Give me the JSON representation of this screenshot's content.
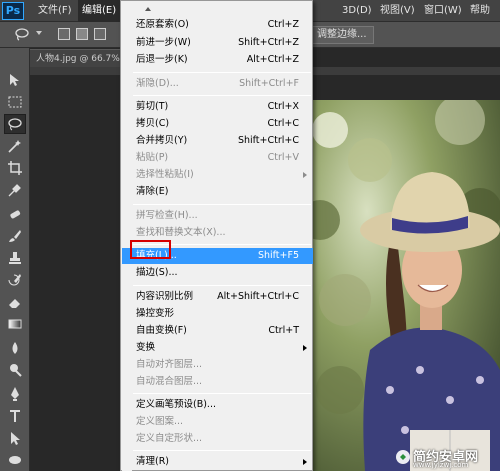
{
  "app": {
    "logo": "Ps"
  },
  "menubar": {
    "items": [
      "文件(F)",
      "编辑(E)",
      "3D(D)",
      "视图(V)",
      "窗口(W)",
      "帮助"
    ],
    "active_index": 1
  },
  "options_bar": {
    "refine_edge_label": "调整边缘..."
  },
  "document": {
    "tab_title": "人物4.jpg @ 66.7%"
  },
  "toolbar": {
    "tools": [
      "move-tool",
      "marquee-tool",
      "lasso-tool",
      "magic-wand-tool",
      "crop-tool",
      "eyedropper-tool",
      "healing-brush-tool",
      "brush-tool",
      "clone-stamp-tool",
      "history-brush-tool",
      "eraser-tool",
      "gradient-tool",
      "blur-tool",
      "dodge-tool",
      "pen-tool",
      "type-tool",
      "path-selection-tool",
      "shape-tool",
      "hand-tool"
    ],
    "selected": "lasso-tool"
  },
  "edit_menu": {
    "items": [
      {
        "label": "还原套索(O)",
        "shortcut": "Ctrl+Z",
        "disabled": false
      },
      {
        "label": "前进一步(W)",
        "shortcut": "Shift+Ctrl+Z",
        "disabled": false
      },
      {
        "label": "后退一步(K)",
        "shortcut": "Alt+Ctrl+Z",
        "disabled": false
      },
      {
        "label": "渐隐(D)...",
        "shortcut": "Shift+Ctrl+F",
        "disabled": true
      },
      {
        "label": "剪切(T)",
        "shortcut": "Ctrl+X",
        "disabled": false
      },
      {
        "label": "拷贝(C)",
        "shortcut": "Ctrl+C",
        "disabled": false
      },
      {
        "label": "合并拷贝(Y)",
        "shortcut": "Shift+Ctrl+C",
        "disabled": false
      },
      {
        "label": "粘贴(P)",
        "shortcut": "Ctrl+V",
        "disabled": true
      },
      {
        "label": "选择性粘贴(I)",
        "shortcut": "",
        "disabled": true,
        "submenu": true
      },
      {
        "label": "清除(E)",
        "shortcut": "",
        "disabled": false
      },
      {
        "label": "拼写检查(H)...",
        "shortcut": "",
        "disabled": true
      },
      {
        "label": "查找和替换文本(X)...",
        "shortcut": "",
        "disabled": true
      },
      {
        "label": "填充(L)...",
        "shortcut": "Shift+F5",
        "disabled": false,
        "highlighted": true
      },
      {
        "label": "描边(S)...",
        "shortcut": "",
        "disabled": false
      },
      {
        "label": "内容识别比例",
        "shortcut": "Alt+Shift+Ctrl+C",
        "disabled": false
      },
      {
        "label": "操控变形",
        "shortcut": "",
        "disabled": false
      },
      {
        "label": "自由变换(F)",
        "shortcut": "Ctrl+T",
        "disabled": false
      },
      {
        "label": "变换",
        "shortcut": "",
        "disabled": false,
        "submenu": true
      },
      {
        "label": "自动对齐图层...",
        "shortcut": "",
        "disabled": true
      },
      {
        "label": "自动混合图层...",
        "shortcut": "",
        "disabled": true
      },
      {
        "label": "定义画笔预设(B)...",
        "shortcut": "",
        "disabled": false
      },
      {
        "label": "定义图案...",
        "shortcut": "",
        "disabled": true
      },
      {
        "label": "定义自定形状...",
        "shortcut": "",
        "disabled": true
      },
      {
        "label": "清理(R)",
        "shortcut": "",
        "disabled": false,
        "submenu": true
      }
    ]
  },
  "watermark": {
    "title": "简约安卓网",
    "url": "www.jylzwj.com"
  },
  "colors": {
    "highlight": "#3399ff",
    "annotation_box": "#d60000",
    "menu_bg": "#f0f0f0",
    "ui_dark": "#535353"
  }
}
